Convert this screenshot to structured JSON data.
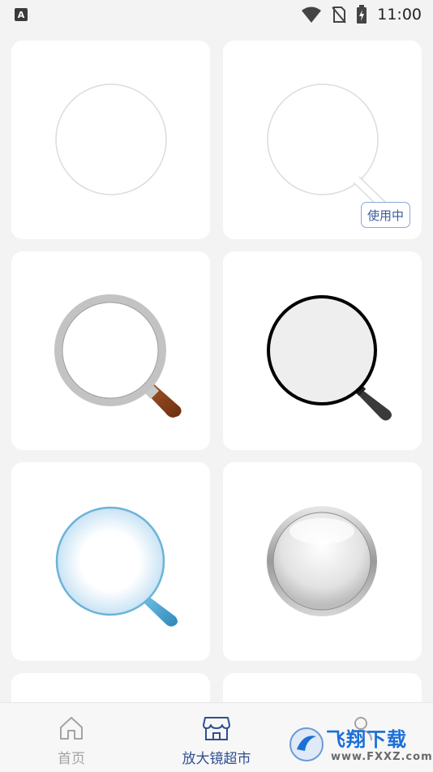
{
  "status_bar": {
    "time": "11:00",
    "app_badge": "A"
  },
  "cards": [
    {
      "name": "plain-circle",
      "in_use": false
    },
    {
      "name": "outline-magnifier",
      "in_use": true
    },
    {
      "name": "silver-wood-magnifier",
      "in_use": false
    },
    {
      "name": "black-ring-magnifier",
      "in_use": false
    },
    {
      "name": "glass-blue-magnifier",
      "in_use": false
    },
    {
      "name": "chrome-lens",
      "in_use": false
    }
  ],
  "badge_label": "使用中",
  "tabs": [
    {
      "label": "首页",
      "icon": "home-icon",
      "active": false
    },
    {
      "label": "放大镜超市",
      "icon": "store-icon",
      "active": true
    },
    {
      "label": "",
      "icon": "user-icon",
      "active": false
    }
  ],
  "colors": {
    "active": "#2f4f8f",
    "inactive": "#a3a3a3"
  },
  "watermark": {
    "text": "飞翔下载",
    "url": "www.FXXZ.com"
  }
}
